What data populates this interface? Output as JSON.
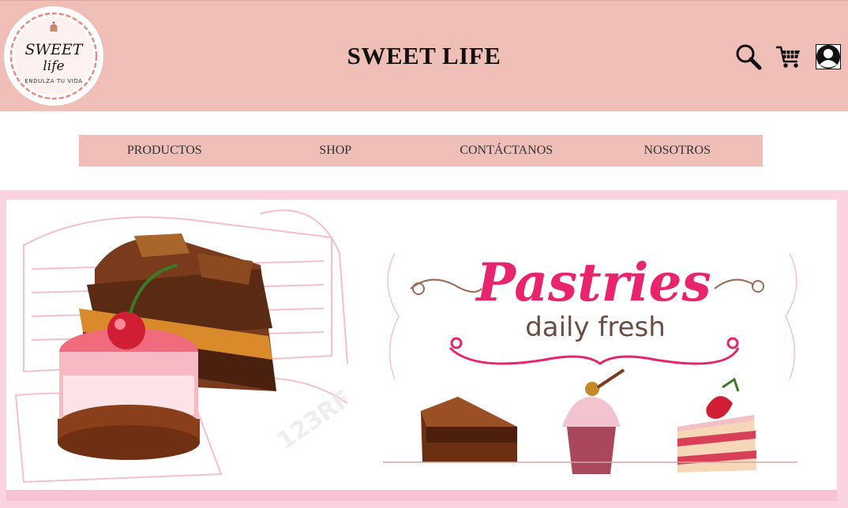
{
  "header": {
    "logo_text_line1": "SWEET",
    "logo_text_line2": "life",
    "logo_tagline": "ENDULZA TU VIDA",
    "title": "SWEET LIFE"
  },
  "nav": {
    "items": [
      {
        "label": "PRODUCTOS"
      },
      {
        "label": "SHOP"
      },
      {
        "label": "CONTÁCTANOS"
      },
      {
        "label": "NOSOTROS"
      }
    ]
  },
  "banner": {
    "headline": "Pastries",
    "subline": "daily fresh",
    "watermark": "123RF"
  },
  "colors": {
    "header_bg": "#efbeb6",
    "nav_bg": "#efbeb6",
    "banner_frame": "#fbd3e0",
    "accent_pink": "#e8246e"
  },
  "icons": {
    "search": "search-icon",
    "cart": "cart-icon",
    "account": "user-icon"
  }
}
